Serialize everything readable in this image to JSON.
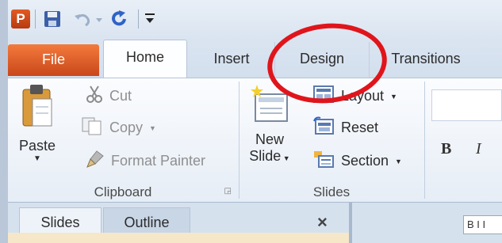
{
  "quick_access": {
    "app_letter": "P"
  },
  "tabs": {
    "file": "File",
    "home": "Home",
    "insert": "Insert",
    "design": "Design",
    "transitions": "Transitions"
  },
  "clipboard": {
    "paste": "Paste",
    "cut": "Cut",
    "copy": "Copy",
    "format_painter": "Format Painter",
    "label": "Clipboard"
  },
  "slides_group": {
    "new_slide_line1": "New",
    "new_slide_line2": "Slide",
    "layout": "Layout",
    "reset": "Reset",
    "section": "Section",
    "label": "Slides"
  },
  "font_group": {
    "bold": "B",
    "italic": "I"
  },
  "pane": {
    "slides_tab": "Slides",
    "outline_tab": "Outline",
    "close": "×"
  },
  "colors": {
    "file_tab": "#d9582a",
    "annotation": "#e0151b"
  },
  "icons": [
    "powerpoint-icon",
    "save-icon",
    "undo-icon",
    "redo-icon",
    "customize-icon",
    "paste-icon",
    "cut-icon",
    "copy-icon",
    "format-painter-icon",
    "new-slide-icon",
    "layout-icon",
    "reset-icon",
    "section-icon",
    "dialog-launcher-icon",
    "close-icon"
  ]
}
